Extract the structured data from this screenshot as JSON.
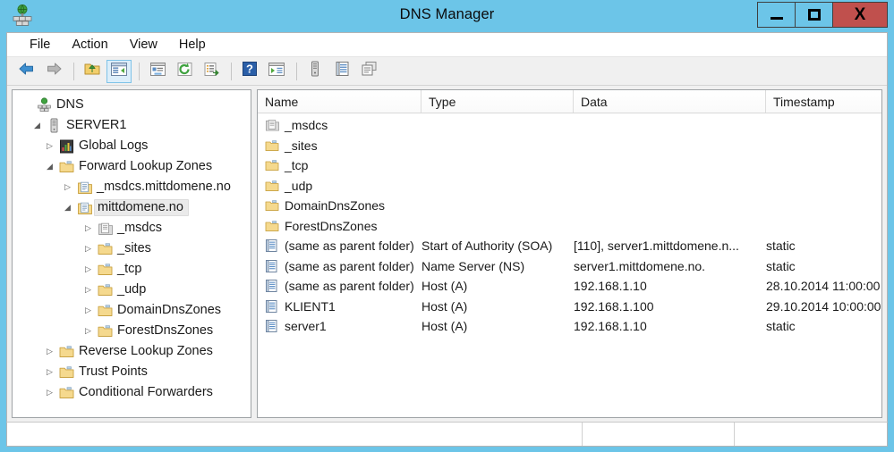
{
  "window": {
    "title": "DNS Manager",
    "app_icon": "dns-server-icon",
    "controls": {
      "minimize": "minimize-button",
      "maximize": "maximize-button",
      "close": "close-button",
      "close_label": "X"
    },
    "colors": {
      "titlebar": "#6CC5E8",
      "close_button": "#C0504D",
      "selection": "#EAEAEA",
      "toolbar_active": "#DCEEFA"
    }
  },
  "menubar": {
    "items": [
      {
        "label": "File"
      },
      {
        "label": "Action"
      },
      {
        "label": "View"
      },
      {
        "label": "Help"
      }
    ]
  },
  "toolbar": {
    "buttons": [
      {
        "icon": "back-arrow-icon",
        "active": false
      },
      {
        "icon": "forward-arrow-icon",
        "active": false
      },
      {
        "icon": "up-folder-icon",
        "active": false
      },
      {
        "icon": "show-tree-pane-icon",
        "active": true
      },
      {
        "icon": "properties-icon",
        "active": false
      },
      {
        "icon": "refresh-icon",
        "active": false
      },
      {
        "icon": "export-list-icon",
        "active": false
      },
      {
        "icon": "help-icon",
        "active": false
      },
      {
        "icon": "show-action-pane-icon",
        "active": false
      },
      {
        "icon": "server-icon",
        "active": false
      },
      {
        "icon": "record-list-icon",
        "active": false
      },
      {
        "icon": "new-zone-icon",
        "active": false
      }
    ]
  },
  "tree": {
    "items": [
      {
        "label": "DNS",
        "indent": 0,
        "twisty": "",
        "icon": "dns-root-icon",
        "selected": false
      },
      {
        "label": "SERVER1",
        "indent": 1,
        "twisty": "expanded",
        "icon": "server-icon",
        "selected": false
      },
      {
        "label": "Global Logs",
        "indent": 2,
        "twisty": "collapsed",
        "icon": "global-logs-icon",
        "selected": false
      },
      {
        "label": "Forward Lookup Zones",
        "indent": 2,
        "twisty": "expanded",
        "icon": "folder-icon",
        "selected": false
      },
      {
        "label": "_msdcs.mittdomene.no",
        "indent": 3,
        "twisty": "collapsed",
        "icon": "zone-icon",
        "selected": false
      },
      {
        "label": "mittdomene.no",
        "indent": 3,
        "twisty": "expanded",
        "icon": "zone-icon",
        "selected": true
      },
      {
        "label": "_msdcs",
        "indent": 4,
        "twisty": "collapsed",
        "icon": "delegation-icon",
        "selected": false
      },
      {
        "label": "_sites",
        "indent": 4,
        "twisty": "collapsed",
        "icon": "folder-icon",
        "selected": false
      },
      {
        "label": "_tcp",
        "indent": 4,
        "twisty": "collapsed",
        "icon": "folder-icon",
        "selected": false
      },
      {
        "label": "_udp",
        "indent": 4,
        "twisty": "collapsed",
        "icon": "folder-icon",
        "selected": false
      },
      {
        "label": "DomainDnsZones",
        "indent": 4,
        "twisty": "collapsed",
        "icon": "folder-icon",
        "selected": false
      },
      {
        "label": "ForestDnsZones",
        "indent": 4,
        "twisty": "collapsed",
        "icon": "folder-icon",
        "selected": false
      },
      {
        "label": "Reverse Lookup Zones",
        "indent": 2,
        "twisty": "collapsed",
        "icon": "folder-icon",
        "selected": false
      },
      {
        "label": "Trust Points",
        "indent": 2,
        "twisty": "collapsed",
        "icon": "folder-icon",
        "selected": false
      },
      {
        "label": "Conditional Forwarders",
        "indent": 2,
        "twisty": "collapsed",
        "icon": "folder-icon",
        "selected": false
      }
    ]
  },
  "list": {
    "columns": [
      {
        "label": "Name"
      },
      {
        "label": "Type"
      },
      {
        "label": "Data"
      },
      {
        "label": "Timestamp"
      }
    ],
    "rows": [
      {
        "icon": "delegation-icon",
        "name": "_msdcs",
        "type": "",
        "data": "",
        "timestamp": ""
      },
      {
        "icon": "folder-icon",
        "name": "_sites",
        "type": "",
        "data": "",
        "timestamp": ""
      },
      {
        "icon": "folder-icon",
        "name": "_tcp",
        "type": "",
        "data": "",
        "timestamp": ""
      },
      {
        "icon": "folder-icon",
        "name": "_udp",
        "type": "",
        "data": "",
        "timestamp": ""
      },
      {
        "icon": "folder-icon",
        "name": "DomainDnsZones",
        "type": "",
        "data": "",
        "timestamp": ""
      },
      {
        "icon": "folder-icon",
        "name": "ForestDnsZones",
        "type": "",
        "data": "",
        "timestamp": ""
      },
      {
        "icon": "record-icon",
        "name": "(same as parent folder)",
        "type": "Start of Authority (SOA)",
        "data": "[110], server1.mittdomene.n...",
        "timestamp": "static"
      },
      {
        "icon": "record-icon",
        "name": "(same as parent folder)",
        "type": "Name Server (NS)",
        "data": "server1.mittdomene.no.",
        "timestamp": "static"
      },
      {
        "icon": "record-icon",
        "name": "(same as parent folder)",
        "type": "Host (A)",
        "data": "192.168.1.10",
        "timestamp": "28.10.2014 11:00:00"
      },
      {
        "icon": "record-icon",
        "name": "KLIENT1",
        "type": "Host (A)",
        "data": "192.168.1.100",
        "timestamp": "29.10.2014 10:00:00"
      },
      {
        "icon": "record-icon",
        "name": "server1",
        "type": "Host (A)",
        "data": "192.168.1.10",
        "timestamp": "static"
      }
    ]
  },
  "statusbar": {
    "panes": [
      {
        "text": ""
      },
      {
        "text": ""
      },
      {
        "text": ""
      }
    ]
  }
}
